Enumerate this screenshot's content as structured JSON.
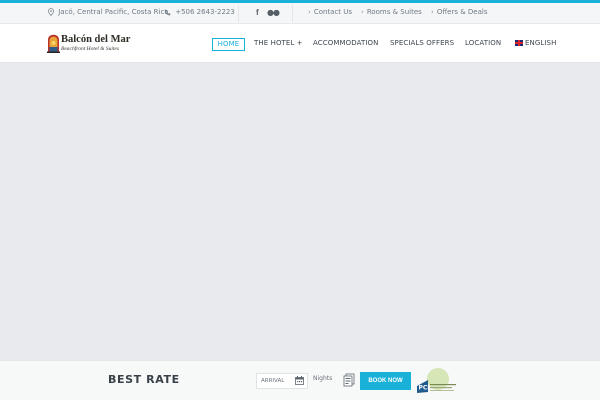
{
  "topbar": {
    "address": "Jacó, Central Pacific, Costa Rica",
    "phone": "+506 2643-2223",
    "links": [
      "Contact Us",
      "Rooms & Suites",
      "Offers & Deals"
    ]
  },
  "logo": {
    "title": "Balcón del Mar",
    "subtitle": "Beachfront Hotel & Suites"
  },
  "nav": {
    "home": "HOME",
    "hotel": "THE HOTEL +",
    "accommodation": "ACCOMMODATION",
    "specials": "SPECIALS OFFERS",
    "location": "LOCATION",
    "language": "ENGLISH"
  },
  "booking": {
    "heading": "BEST RATE",
    "arrival_placeholder": "ARRIVAL",
    "nights_label": "Nights",
    "book_button": "BOOK NOW",
    "badge_label": "PCI"
  },
  "colors": {
    "accent": "#1ab1d8",
    "hero_bg": "#e8eaed"
  }
}
